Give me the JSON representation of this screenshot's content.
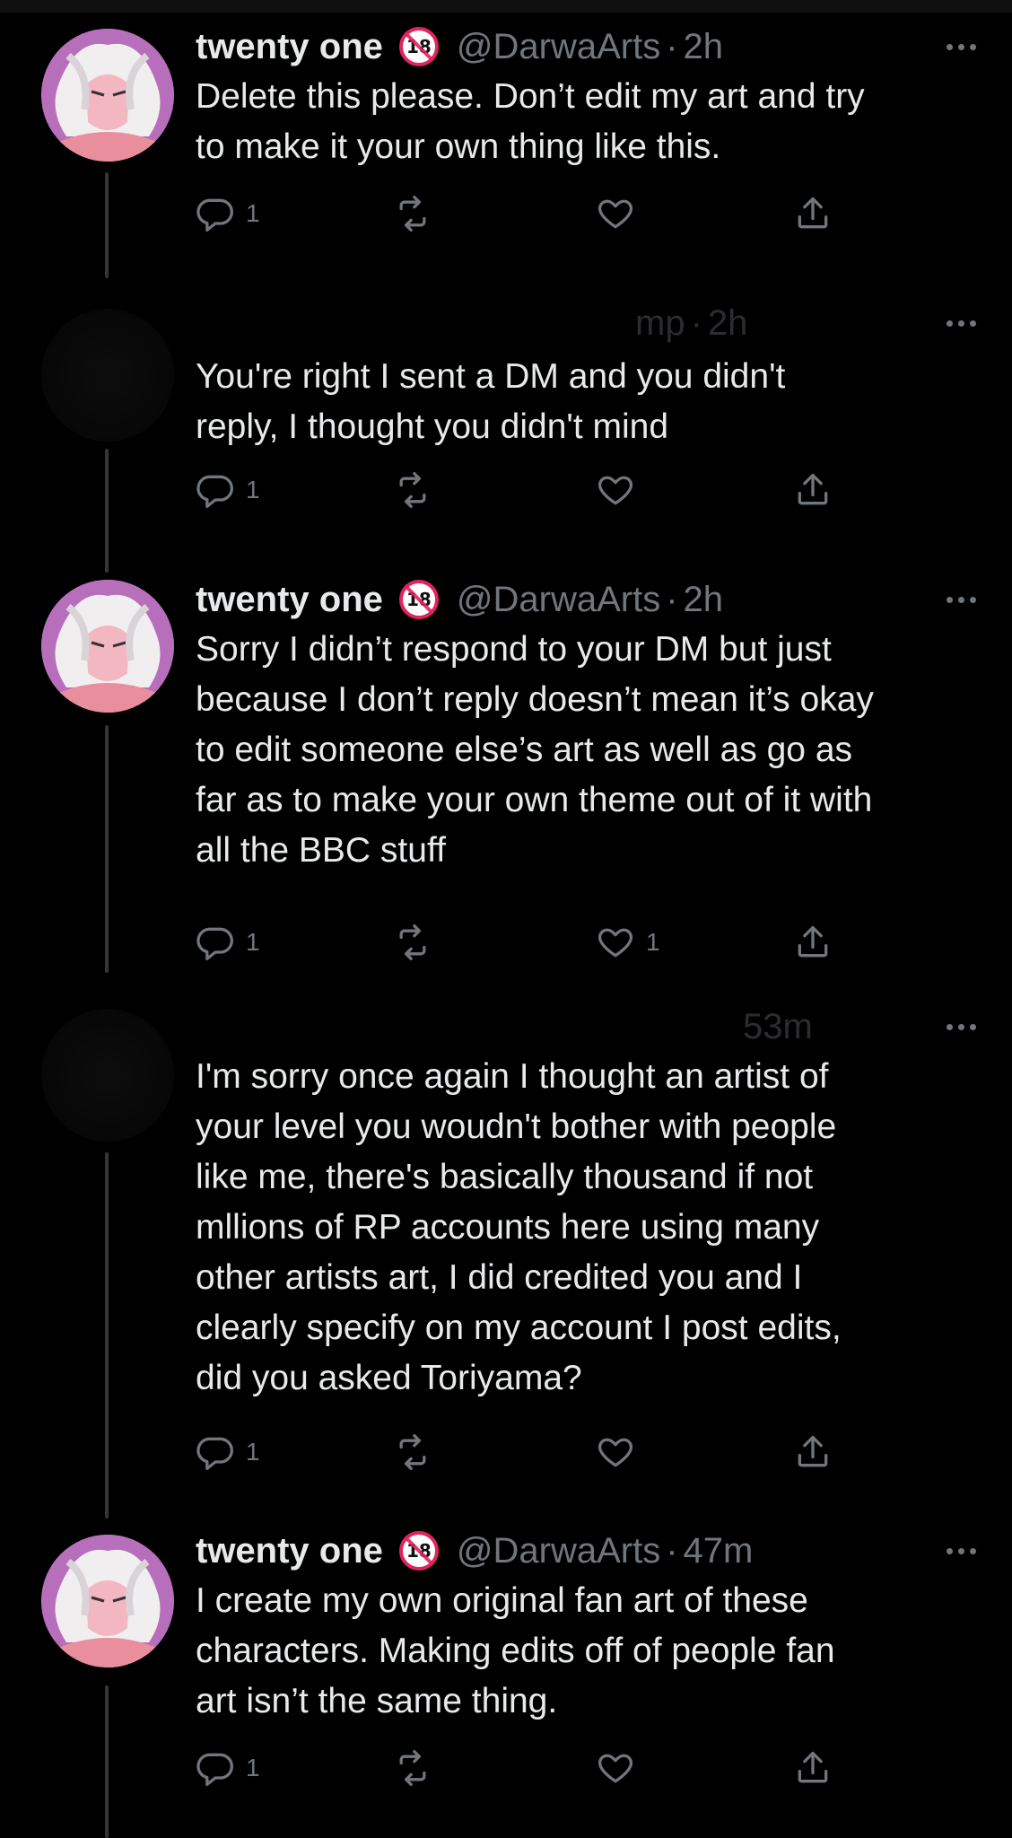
{
  "icons": {
    "reply": "reply-icon",
    "retweet": "retweet-icon",
    "like": "heart-icon",
    "share": "share-icon",
    "more": "more-icon",
    "nsfw_badge": "18-badge-icon"
  },
  "colors": {
    "background": "#000000",
    "text": "#e7e9ea",
    "muted": "#71767b",
    "badge_red": "#e0245e",
    "avatar_purple": "#b06ab3"
  },
  "tweets": [
    {
      "name": "twenty one",
      "handle": "@DarwaArts",
      "time": "2h",
      "lines": [
        "Delete this please. Don’t edit my art and try",
        "to make it your own thing like this."
      ],
      "reply_count": "1",
      "like_count": ""
    },
    {
      "name": "",
      "handle": "",
      "handle_fragment": "mp",
      "time": "2h",
      "lines": [
        "You're right  I sent a DM and you didn't",
        "reply, I thought you didn't mind"
      ],
      "reply_count": "1",
      "like_count": ""
    },
    {
      "name": "twenty one",
      "handle": "@DarwaArts",
      "time": "2h",
      "lines": [
        "Sorry I didn’t respond to your DM but just",
        "because I don’t reply doesn’t mean it’s okay",
        "to edit someone else’s art as well as go as",
        "far as to make your own theme out of it with",
        "all the BBC stuff"
      ],
      "reply_count": "1",
      "like_count": "1"
    },
    {
      "name": "",
      "handle": "",
      "time": "53m",
      "lines": [
        "I'm sorry once again I thought an artist of",
        "your level you woudn't bother with people",
        "like me, there's basically thousand if not",
        "mllions of RP accounts here using many",
        "other artists art, I did credited you and I",
        "clearly specify on my account I post edits,",
        "did you asked Toriyama?"
      ],
      "reply_count": "1",
      "like_count": ""
    },
    {
      "name": "twenty one",
      "handle": "@DarwaArts",
      "time": "47m",
      "lines": [
        "I create my own original fan art of these",
        "characters. Making edits off of people fan",
        "art isn’t the same thing."
      ],
      "reply_count": "1",
      "like_count": ""
    }
  ]
}
